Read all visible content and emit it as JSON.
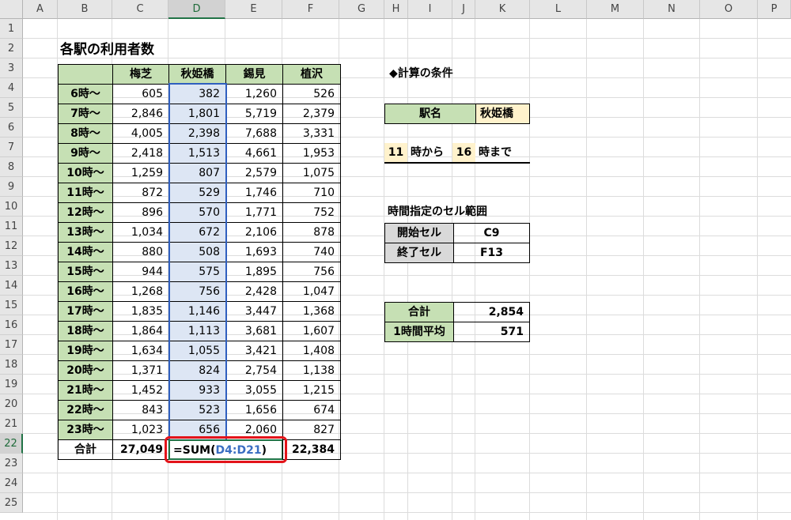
{
  "columns": [
    "A",
    "B",
    "C",
    "D",
    "E",
    "F",
    "G",
    "H",
    "I",
    "J",
    "K",
    "L",
    "M",
    "N",
    "O",
    "P"
  ],
  "rows": [
    "1",
    "2",
    "3",
    "4",
    "5",
    "6",
    "7",
    "8",
    "9",
    "10",
    "11",
    "12",
    "13",
    "14",
    "15",
    "16",
    "17",
    "18",
    "19",
    "20",
    "21",
    "22",
    "23",
    "24",
    "25"
  ],
  "title": "各駅の利用者数",
  "table": {
    "headers": [
      "梅芝",
      "秋姫橋",
      "錫見",
      "植沢"
    ],
    "rows": [
      {
        "label": "6時～",
        "values": [
          "605",
          "382",
          "1,260",
          "526"
        ]
      },
      {
        "label": "7時～",
        "values": [
          "2,846",
          "1,801",
          "5,719",
          "2,379"
        ]
      },
      {
        "label": "8時～",
        "values": [
          "4,005",
          "2,398",
          "7,688",
          "3,331"
        ]
      },
      {
        "label": "9時～",
        "values": [
          "2,418",
          "1,513",
          "4,661",
          "1,953"
        ]
      },
      {
        "label": "10時～",
        "values": [
          "1,259",
          "807",
          "2,579",
          "1,075"
        ]
      },
      {
        "label": "11時～",
        "values": [
          "872",
          "529",
          "1,746",
          "710"
        ]
      },
      {
        "label": "12時～",
        "values": [
          "896",
          "570",
          "1,771",
          "752"
        ]
      },
      {
        "label": "13時～",
        "values": [
          "1,034",
          "672",
          "2,106",
          "878"
        ]
      },
      {
        "label": "14時～",
        "values": [
          "880",
          "508",
          "1,693",
          "740"
        ]
      },
      {
        "label": "15時～",
        "values": [
          "944",
          "575",
          "1,895",
          "756"
        ]
      },
      {
        "label": "16時～",
        "values": [
          "1,268",
          "756",
          "2,428",
          "1,047"
        ]
      },
      {
        "label": "17時～",
        "values": [
          "1,835",
          "1,146",
          "3,447",
          "1,368"
        ]
      },
      {
        "label": "18時～",
        "values": [
          "1,864",
          "1,113",
          "3,681",
          "1,607"
        ]
      },
      {
        "label": "19時～",
        "values": [
          "1,634",
          "1,055",
          "3,421",
          "1,408"
        ]
      },
      {
        "label": "20時～",
        "values": [
          "1,371",
          "824",
          "2,754",
          "1,138"
        ]
      },
      {
        "label": "21時～",
        "values": [
          "1,452",
          "933",
          "3,055",
          "1,215"
        ]
      },
      {
        "label": "22時～",
        "values": [
          "843",
          "523",
          "1,656",
          "674"
        ]
      },
      {
        "label": "23時～",
        "values": [
          "1,023",
          "656",
          "2,060",
          "827"
        ]
      }
    ],
    "total_label": "合計",
    "total_c": "27,049",
    "formula_prefix": "=SUM(",
    "formula_ref": "D4:D21",
    "formula_suffix": ")",
    "total_f": "22,384"
  },
  "conditions": {
    "heading": "◆計算の条件",
    "station_label": "駅名",
    "station_value": "秋姫橋",
    "from_hour": "11",
    "from_text": "時から",
    "to_hour": "16",
    "to_text": "時まで"
  },
  "range": {
    "heading": "時間指定のセル範囲",
    "start_label": "開始セル",
    "start_value": "C9",
    "end_label": "終了セル",
    "end_value": "F13"
  },
  "summary": {
    "total_label": "合計",
    "total_value": "2,854",
    "avg_label": "1時間平均",
    "avg_value": "571"
  },
  "colors": {
    "header_green": "#c6e0b4",
    "highlight_blue": "#dde6f4",
    "input_yellow": "#fff2cc",
    "label_gray": "#d9d9d9",
    "annotation_red": "#e3141a"
  }
}
